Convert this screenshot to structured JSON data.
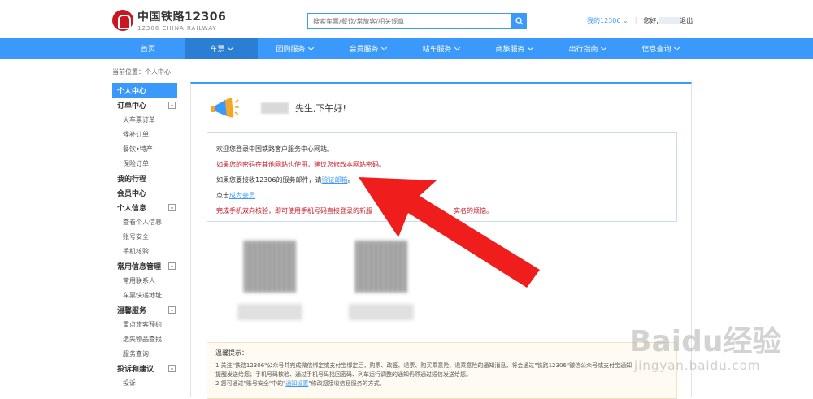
{
  "header": {
    "logo_cn": "中国铁路12306",
    "logo_en": "12306 CHINA RAILWAY",
    "search_placeholder": "搜索车票/餐饮/常旅客/相关规章",
    "my12306": "我的12306",
    "greeting_prefix": "您好,",
    "logout": "退出"
  },
  "nav": [
    {
      "label": "首页",
      "caret": false,
      "active": false
    },
    {
      "label": "车票",
      "caret": true,
      "active": true
    },
    {
      "label": "团购服务",
      "caret": true,
      "active": false
    },
    {
      "label": "会员服务",
      "caret": true,
      "active": false
    },
    {
      "label": "站车服务",
      "caret": true,
      "active": false
    },
    {
      "label": "商旅服务",
      "caret": true,
      "active": false
    },
    {
      "label": "出行指南",
      "caret": true,
      "active": false
    },
    {
      "label": "信息查询",
      "caret": true,
      "active": false
    }
  ],
  "breadcrumb": "当前位置：个人中心",
  "sidebar": [
    {
      "label": "个人中心",
      "kind": "active"
    },
    {
      "label": "订单中心",
      "kind": "group",
      "toggle": "-"
    },
    {
      "label": "火车票订单",
      "kind": "sub"
    },
    {
      "label": "候补订单",
      "kind": "sub"
    },
    {
      "label": "餐饮•特产",
      "kind": "sub"
    },
    {
      "label": "保险订单",
      "kind": "sub"
    },
    {
      "label": "我的行程",
      "kind": "group"
    },
    {
      "label": "会员中心",
      "kind": "group"
    },
    {
      "label": "个人信息",
      "kind": "group",
      "toggle": "-"
    },
    {
      "label": "查看个人信息",
      "kind": "sub"
    },
    {
      "label": "账号安全",
      "kind": "sub"
    },
    {
      "label": "手机核验",
      "kind": "sub"
    },
    {
      "label": "常用信息管理",
      "kind": "group",
      "toggle": "-"
    },
    {
      "label": "常用联系人",
      "kind": "sub"
    },
    {
      "label": "车票快递地址",
      "kind": "sub"
    },
    {
      "label": "温馨服务",
      "kind": "group",
      "toggle": "-"
    },
    {
      "label": "重点旅客预约",
      "kind": "sub"
    },
    {
      "label": "遗失物品查找",
      "kind": "sub"
    },
    {
      "label": "服务查询",
      "kind": "sub"
    },
    {
      "label": "投诉和建议",
      "kind": "group",
      "toggle": "-"
    },
    {
      "label": "投诉",
      "kind": "sub"
    }
  ],
  "main": {
    "greeting": "先生,下午好!",
    "info": {
      "line1": "欢迎您登录中国铁路客户服务中心网站。",
      "line2": "如果您的密码在其他网站也使用，建议您修改本网站密码。",
      "line3_prefix": "如果您要接收12306的服务邮件，请",
      "line3_link": "验证邮箱",
      "line3_suffix": "。",
      "line4_prefix": "点击",
      "line4_link": "成为会员",
      "line5": "完成手机双向核验，即可使用手机号码直接登录的新服",
      "line5_tail": "实名的烦恼。"
    },
    "tips": {
      "title": "温馨提示：",
      "line1": "1.关注\"铁路12306\"公众号并完成微信绑定或支付宝绑定后，购票、改签、退票、购买乘意险、退乘意险的通知消息，将会通过\"铁路12306\"微信公众号或支付宝通知",
      "line2": "提醒发送给您；手机号码核验、通过手机号码找回密码、列车运行调整的通知仍然通过短信发送给您。",
      "line3_prefix": "2.您可通过\"账号安全\"中的\"",
      "line3_link": "通知设置",
      "line3_suffix": "\"修改您接收信息服务的方式。"
    }
  },
  "watermark": {
    "brand": "Baidu经验",
    "url": "jingyan.baidu.com"
  },
  "colors": {
    "accent": "#3b99fc",
    "red": "#c81623",
    "arrow": "#f01d1d"
  }
}
